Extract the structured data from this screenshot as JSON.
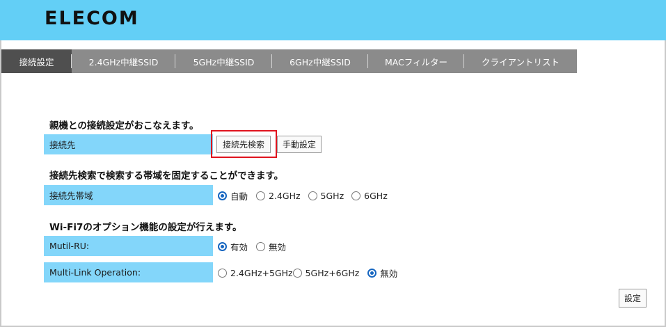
{
  "brand": {
    "logo_text": "ELECOM"
  },
  "tabs": [
    {
      "label": "接続設定",
      "active": true
    },
    {
      "label": "2.4GHz中継SSID",
      "active": false
    },
    {
      "label": "5GHz中継SSID",
      "active": false
    },
    {
      "label": "6GHz中継SSID",
      "active": false
    },
    {
      "label": "MACフィルター",
      "active": false
    },
    {
      "label": "クライアントリスト",
      "active": false
    }
  ],
  "connection": {
    "title": "親機との接続設定がおこなえます。",
    "label": "接続先",
    "search_button": "接続先検索",
    "manual_button": "手動設定",
    "highlight_color": "#e0141e"
  },
  "band": {
    "title": "接続先検索で検索する帯域を固定することができます。",
    "label": "接続先帯域",
    "options": [
      {
        "label": "自動",
        "checked": true
      },
      {
        "label": "2.4GHz",
        "checked": false
      },
      {
        "label": "5GHz",
        "checked": false
      },
      {
        "label": "6GHz",
        "checked": false
      }
    ]
  },
  "wifi7": {
    "title": "Wi-Fi7のオプション機能の設定が行えます。",
    "mru": {
      "label": "Mutil-RU:",
      "options": [
        {
          "label": "有効",
          "checked": true
        },
        {
          "label": "無効",
          "checked": false
        }
      ]
    },
    "mlo": {
      "label": "Multi-Link Operation:",
      "options": [
        {
          "label": "2.4GHz+5GHz",
          "checked": false
        },
        {
          "label": "5GHz+6GHz",
          "checked": false
        },
        {
          "label": "無効",
          "checked": true
        }
      ]
    }
  },
  "apply_button": "設定",
  "colors": {
    "header": "#63cff6",
    "tab_bar": "#8b8b8b",
    "tab_active": "#4f4f4f",
    "label_bg": "#83d6fa",
    "radio_accent": "#1565c0"
  }
}
